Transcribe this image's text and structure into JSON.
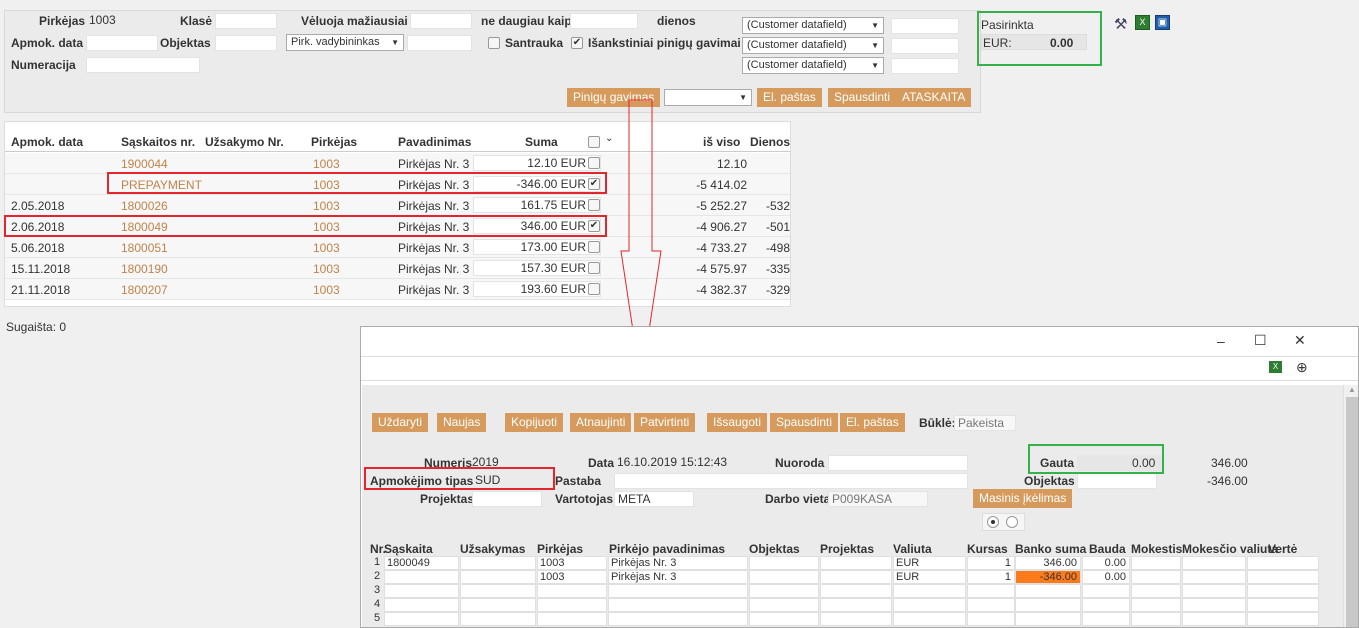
{
  "filter": {
    "pirkejas_label": "Pirkėjas",
    "pirkejas_value": "1003",
    "klase_label": "Klasė",
    "veluoja_label": "Vėluoja mažiausiai",
    "ne_daugiau_label": "ne daugiau kaip",
    "dienos_label": "dienos",
    "apmok_data_label": "Apmok. data",
    "objektas_label": "Objektas",
    "vadyb_select": "Pirk. vadybininkas",
    "santrauka_label": "Santrauka",
    "isankstiniai_label": "Išankstiniai pinigų gavimai",
    "numeracija_label": "Numeracija",
    "cf1": "(Customer datafield)",
    "cf2": "(Customer datafield)",
    "cf3": "(Customer datafield)",
    "btn_pinigu": "Pinigų gavimas",
    "btn_elpastas": "El. paštas",
    "btn_spausdinti": "Spausdinti",
    "btn_ataskaita": "ATASKAITA"
  },
  "selected": {
    "title": "Pasirinkta",
    "currency": "EUR:",
    "value": "0.00"
  },
  "grid": {
    "headers": {
      "apmok": "Apmok. data",
      "saskaitos": "Sąskaitos nr.",
      "uzsakymo": "Užsakymo Nr.",
      "pirkejas": "Pirkėjas",
      "pavadinimas": "Pavadinimas",
      "suma": "Suma",
      "is_viso": "iš viso",
      "dienos": "Dienos"
    },
    "rows": [
      {
        "date": "",
        "inv": "1900044",
        "buyer": "1003",
        "name": "Pirkėjas Nr. 3",
        "sum": "12.10 EUR",
        "checked": "",
        "total": "12.10",
        "days": ""
      },
      {
        "date": "",
        "inv": "PREPAYMENT",
        "buyer": "1003",
        "name": "Pirkėjas Nr. 3",
        "sum": "-346.00 EUR",
        "checked": "✔",
        "total": "-5 414.02",
        "days": ""
      },
      {
        "date": "2.05.2018",
        "inv": "1800026",
        "buyer": "1003",
        "name": "Pirkėjas Nr. 3",
        "sum": "161.75 EUR",
        "checked": "",
        "total": "-5 252.27",
        "days": "-532"
      },
      {
        "date": "2.06.2018",
        "inv": "1800049",
        "buyer": "1003",
        "name": "Pirkėjas Nr. 3",
        "sum": "346.00 EUR",
        "checked": "✔",
        "total": "-4 906.27",
        "days": "-501"
      },
      {
        "date": "5.06.2018",
        "inv": "1800051",
        "buyer": "1003",
        "name": "Pirkėjas Nr. 3",
        "sum": "173.00 EUR",
        "checked": "",
        "total": "-4 733.27",
        "days": "-498"
      },
      {
        "date": "15.11.2018",
        "inv": "1800190",
        "buyer": "1003",
        "name": "Pirkėjas Nr. 3",
        "sum": "157.30 EUR",
        "checked": "",
        "total": "-4 575.97",
        "days": "-335"
      },
      {
        "date": "21.11.2018",
        "inv": "1800207",
        "buyer": "1003",
        "name": "Pirkėjas Nr. 3",
        "sum": "193.60 EUR",
        "checked": "",
        "total": "-4 382.37",
        "days": "-329"
      }
    ]
  },
  "sugaista": "Sugaišta: 0",
  "dialog": {
    "minimize": "–",
    "maximize": "☐",
    "close": "✕",
    "zoom": "⊕",
    "buttons": {
      "uzdaryti": "Uždaryti",
      "naujas": "Naujas",
      "kopijuoti": "Kopijuoti",
      "atnaujinti": "Atnaujinti",
      "patvirtinti": "Patvirtinti",
      "issaugoti": "Išsaugoti",
      "spausdinti": "Spausdinti",
      "elpastas": "El. paštas"
    },
    "bukle_label": "Būklė:",
    "bukle_value": "Pakeista",
    "numeris_label": "Numeris",
    "numeris_value": "2019",
    "data_label": "Data",
    "data_value": "16.10.2019 15:12:43",
    "nuoroda_label": "Nuoroda",
    "gauta_label": "Gauta",
    "gauta_value": "0.00",
    "gauta_total": "346.00",
    "apmokejimo_label": "Apmokėjimo tipas",
    "apmokejimo_value": "SUD",
    "pastaba_label": "Pastaba",
    "objektas_label": "Objektas",
    "objektas_total": "-346.00",
    "projektas_label": "Projektas",
    "vartotojas_label": "Vartotojas",
    "vartotojas_value": "META",
    "darbo_vieta_label": "Darbo vieta",
    "darbo_vieta_value": "P009KASA",
    "masinis_btn": "Masinis įkėlimas",
    "table_headers": {
      "nr": "Nr.",
      "saskaita": "Sąskaita",
      "uzsakymas": "Užsakymas",
      "pirkejas": "Pirkėjas",
      "pirkejo_pav": "Pirkėjo pavadinimas",
      "objektas": "Objektas",
      "projektas": "Projektas",
      "valiuta": "Valiuta",
      "kursas": "Kursas",
      "banko_suma": "Banko suma",
      "bauda": "Bauda",
      "mokestis": "Mokestis",
      "mok_valiuta": "Mokesčio valiuta",
      "verte": "Vertė"
    },
    "rows": [
      {
        "nr": "1",
        "saskaita": "1800049",
        "pirkejas": "1003",
        "pav": "Pirkėjas Nr. 3",
        "valiuta": "EUR",
        "kursas": "1",
        "banko": "346.00",
        "bauda": "0.00"
      },
      {
        "nr": "2",
        "saskaita": "",
        "pirkejas": "1003",
        "pav": "Pirkėjas Nr. 3",
        "valiuta": "EUR",
        "kursas": "1",
        "banko": "-346.00",
        "bauda": "0.00"
      },
      {
        "nr": "3"
      },
      {
        "nr": "4"
      },
      {
        "nr": "5"
      }
    ]
  },
  "colors": {
    "accent": "#d69a5c",
    "highlight_green": "#33b24a",
    "highlight_red": "#e3262c",
    "negative_cell": "#ff7a1a"
  }
}
